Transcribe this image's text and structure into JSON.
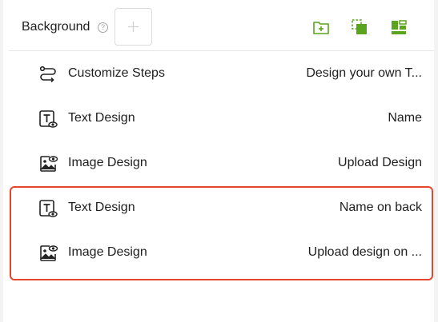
{
  "header": {
    "title": "Background",
    "help_icon": "question-circle-icon",
    "add_icon": "plus-icon",
    "actions": [
      "folder-add-icon",
      "copy-icon",
      "layout-icon"
    ],
    "accent_color": "#5aa41e"
  },
  "rows": [
    {
      "label": "Customize Steps",
      "value": "Design your own T...",
      "icon": "steps-icon"
    },
    {
      "label": "Text Design",
      "value": "Name",
      "icon": "text-design-icon"
    },
    {
      "label": "Image Design",
      "value": "Upload Design",
      "icon": "image-design-icon"
    },
    {
      "label": "Text Design",
      "value": "Name on back",
      "icon": "text-design-icon"
    },
    {
      "label": "Image Design",
      "value": "Upload design on ...",
      "icon": "image-design-icon"
    }
  ],
  "highlight_color": "#e8452c"
}
